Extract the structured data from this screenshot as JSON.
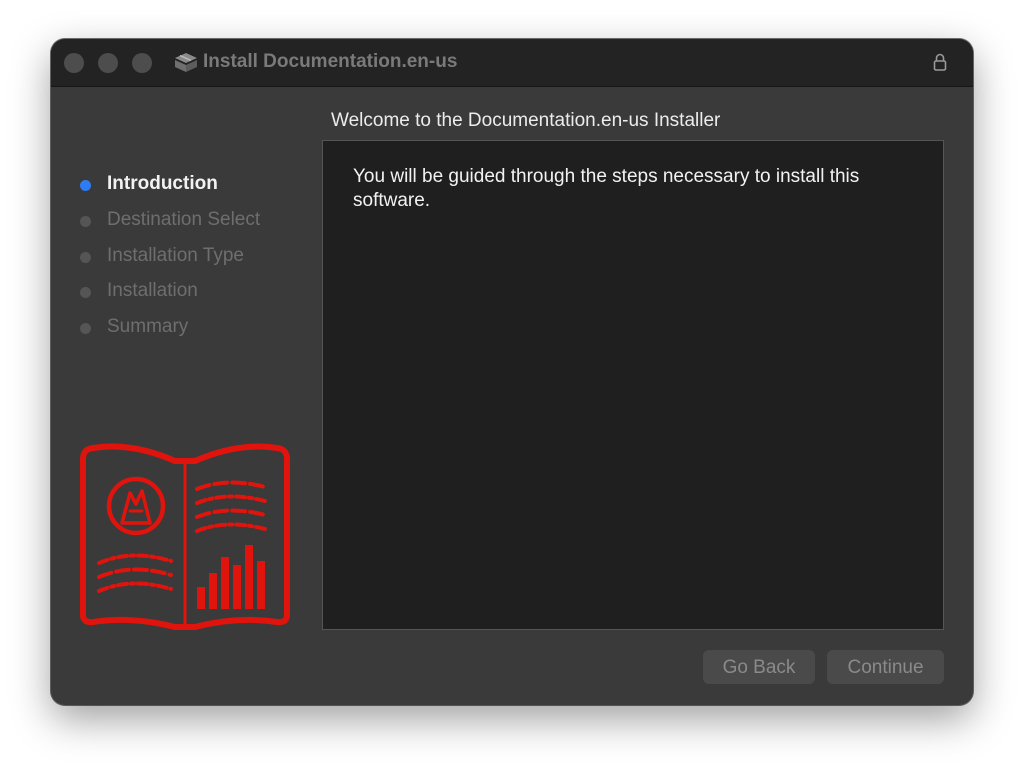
{
  "window": {
    "title": "Install Documentation.en-us",
    "title_icon": "package-icon",
    "lock_icon": "lock-icon"
  },
  "sidebar": {
    "steps": [
      {
        "label": "Introduction",
        "active": true
      },
      {
        "label": "Destination Select",
        "active": false
      },
      {
        "label": "Installation Type",
        "active": false
      },
      {
        "label": "Installation",
        "active": false
      },
      {
        "label": "Summary",
        "active": false
      }
    ],
    "illustration": "documentation-book-icon"
  },
  "main": {
    "heading": "Welcome to the Documentation.en-us Installer",
    "body": "You will be guided through the steps necessary to install this software."
  },
  "buttons": {
    "back": "Go Back",
    "continue": "Continue"
  },
  "colors": {
    "accent": "#2d7cf6",
    "illustration": "#e0140d"
  }
}
